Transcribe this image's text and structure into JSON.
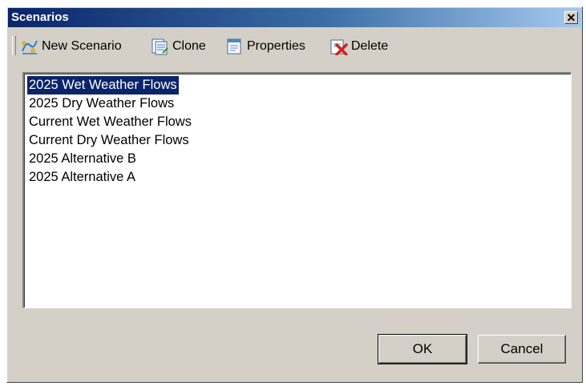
{
  "window": {
    "title": "Scenarios",
    "close_glyph": "✕"
  },
  "toolbar": {
    "new_label": "New Scenario",
    "clone_label": "Clone",
    "properties_label": "Properties",
    "delete_label": "Delete"
  },
  "scenarios": {
    "items": [
      "2025 Wet Weather Flows",
      "2025 Dry Weather Flows",
      "Current Wet Weather Flows",
      "Current Dry Weather Flows",
      "2025 Alternative B",
      "2025 Alternative A"
    ],
    "selected_index": 0
  },
  "buttons": {
    "ok_label": "OK",
    "cancel_label": "Cancel"
  },
  "colors": {
    "selection": "#0a246a",
    "dialog_face": "#d4d0c8"
  }
}
